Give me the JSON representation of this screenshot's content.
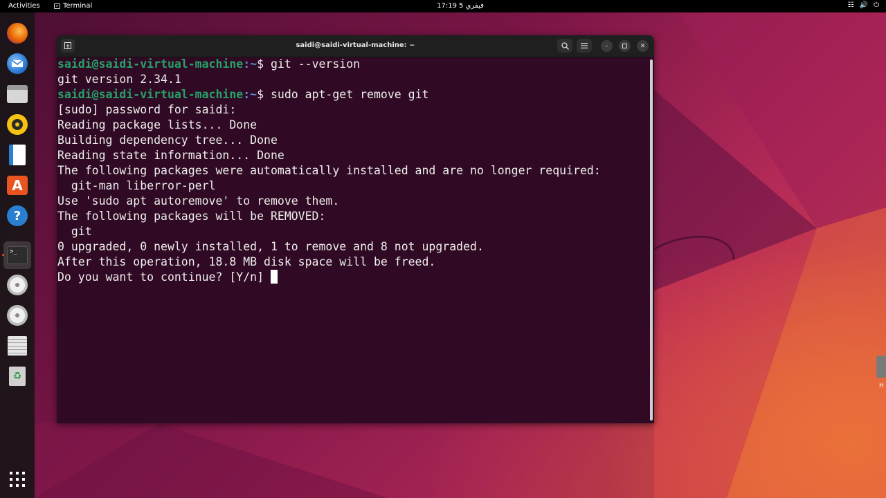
{
  "topbar": {
    "activities": "Activities",
    "app_name": "Terminal",
    "clock": "17:19 فيفري 5",
    "tray_icons": [
      "network-icon",
      "volume-icon",
      "power-icon"
    ]
  },
  "dock": {
    "items": [
      {
        "name": "firefox-icon",
        "color": "#e66000"
      },
      {
        "name": "thunderbird-icon",
        "color": "#2a79d4"
      },
      {
        "name": "files-icon",
        "color": "#b0b0b0"
      },
      {
        "name": "rhythmbox-icon",
        "color": "#f5c211"
      },
      {
        "name": "libreoffice-writer-icon",
        "color": "#2a7fd1"
      },
      {
        "name": "app-center-icon",
        "color": "#e95420"
      },
      {
        "name": "help-icon",
        "color": "#2a7fd1"
      },
      {
        "name": "terminal-icon",
        "color": "#2c2c2c"
      },
      {
        "name": "disc-icon",
        "color": "#dcdcdc"
      },
      {
        "name": "disc-icon",
        "color": "#dcdcdc"
      },
      {
        "name": "save-disk-icon",
        "color": "#e0e0e0"
      },
      {
        "name": "trash-icon",
        "color": "#c8c8c8"
      }
    ],
    "apps_grid": "show-apps-icon"
  },
  "window": {
    "title": "saidi@saidi-virtual-machine: ~"
  },
  "terminal": {
    "user_host": "saidi@saidi-virtual-machine",
    "path": ":~",
    "lines": [
      {
        "type": "prompt",
        "cmd": "$ git --version"
      },
      {
        "type": "out",
        "text": "git version 2.34.1"
      },
      {
        "type": "prompt",
        "cmd": "$ sudo apt-get remove git"
      },
      {
        "type": "out",
        "text": "[sudo] password for saidi:"
      },
      {
        "type": "out",
        "text": "Reading package lists... Done"
      },
      {
        "type": "out",
        "text": "Building dependency tree... Done"
      },
      {
        "type": "out",
        "text": "Reading state information... Done"
      },
      {
        "type": "out",
        "text": "The following packages were automatically installed and are no longer required:"
      },
      {
        "type": "out",
        "text": "  git-man liberror-perl"
      },
      {
        "type": "out",
        "text": "Use 'sudo apt autoremove' to remove them."
      },
      {
        "type": "out",
        "text": "The following packages will be REMOVED:"
      },
      {
        "type": "out",
        "text": "  git"
      },
      {
        "type": "out",
        "text": "0 upgraded, 0 newly installed, 1 to remove and 8 not upgraded."
      },
      {
        "type": "out",
        "text": "After this operation, 18.8 MB disk space will be freed."
      },
      {
        "type": "input",
        "text": "Do you want to continue? [Y/n] "
      }
    ]
  },
  "desktop": {
    "icon_label": "H"
  }
}
